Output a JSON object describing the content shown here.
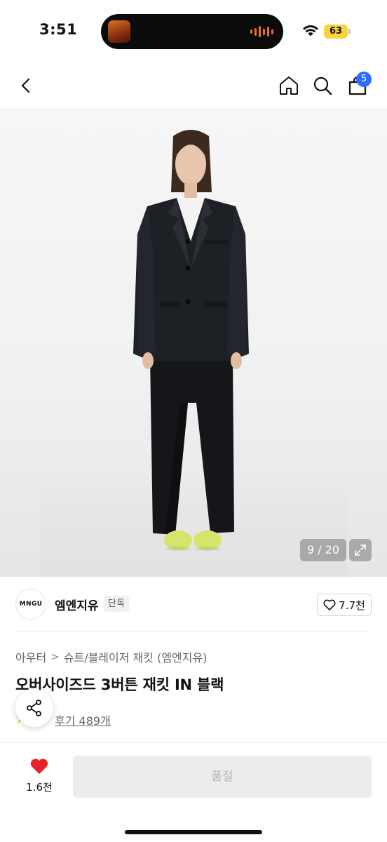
{
  "status_bar": {
    "time": "3:51",
    "battery": "63",
    "icons": [
      "now-playing-artwork",
      "audio-waveform-icon",
      "wifi-icon",
      "battery-icon"
    ]
  },
  "nav": {
    "icons": [
      "chevron-left-icon",
      "home-icon",
      "search-icon",
      "shopping-bag-icon"
    ],
    "cart_badge": "5"
  },
  "gallery": {
    "counter": "9 / 20",
    "expand_icon": "expand-icon"
  },
  "brand": {
    "logo_text": "MNGU",
    "name": "엠엔지유",
    "tag": "단독",
    "likes": "7.7천"
  },
  "product": {
    "breadcrumb": {
      "category": "아우터",
      "separator": ">",
      "subcategory": "슈트/블레이저 재킷 (엠엔지유)"
    },
    "title": "오버사이즈드 3버튼 재킷 IN 블랙",
    "review_link": "후기 489개"
  },
  "bottom_bar": {
    "wish_count": "1.6천",
    "cta_label": "품절"
  },
  "colors": {
    "accent_blue": "#2f6bff",
    "heart_red": "#e8212b",
    "battery_yellow": "#f7d33c",
    "disabled_bg": "#ececec",
    "disabled_text": "#b8b8b8"
  }
}
